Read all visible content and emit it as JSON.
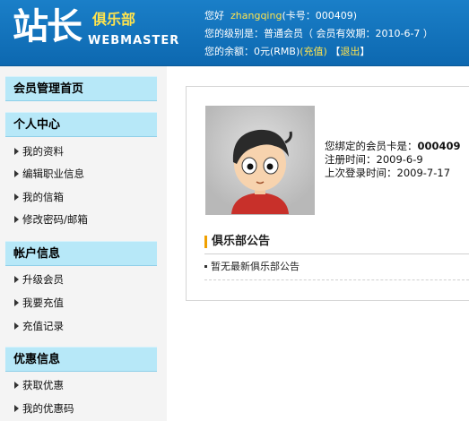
{
  "logo": {
    "main": "站长",
    "club": "俱乐部",
    "sub": "WEBMASTER"
  },
  "header": {
    "greet_prefix": "您好",
    "username": "zhangqing",
    "card_text": "(卡号：000409)",
    "level_text": "您的级别是：普通会员（ 会员有效期：2010-6-7 ）",
    "balance_prefix": "您的余额：0元(RMB)",
    "recharge_label": "(充值)",
    "bracket_open": "【",
    "logout_label": "退出",
    "bracket_close": "】"
  },
  "sidebar": {
    "home": "会员管理首页",
    "sections": [
      {
        "title": "个人中心",
        "items": [
          "我的资料",
          "编辑职业信息",
          "我的信箱",
          "修改密码/邮箱"
        ]
      },
      {
        "title": "帐户信息",
        "items": [
          "升级会员",
          "我要充值",
          "充值记录"
        ]
      },
      {
        "title": "优惠信息",
        "items": [
          "获取优惠",
          "我的优惠码"
        ]
      }
    ]
  },
  "profile": {
    "card_label": "您绑定的会员卡是：",
    "card_no": "000409",
    "reg_label": "注册时间：2009-6-9",
    "last_login": "上次登录时间：2009-7-17"
  },
  "notice": {
    "title": "俱乐部公告",
    "item": "暂无最新俱乐部公告"
  }
}
